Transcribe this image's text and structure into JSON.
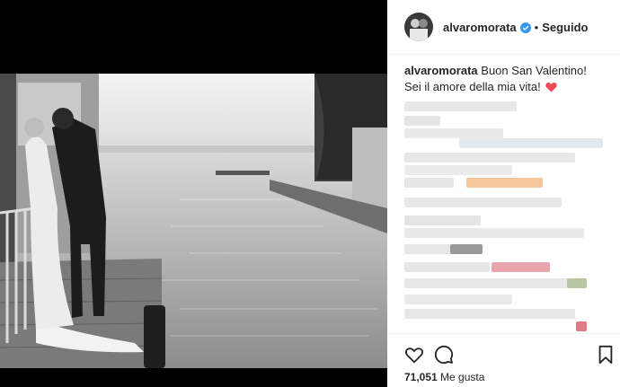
{
  "post": {
    "username": "alvaromorata",
    "follow_status": "Seguido",
    "separator": "•",
    "caption_text": "Buon San Valentino! Sei il amore della mia vita!",
    "likes_count": "71,051",
    "likes_label": "Me gusta"
  },
  "colors": {
    "text": "#262626",
    "verified": "#3897f0",
    "heart": "#ed4956",
    "blur": "#e6e6e6"
  },
  "icons": {
    "like": "heart-outline-icon",
    "comment": "speech-bubble-icon",
    "save": "bookmark-icon",
    "verified": "verified-badge-icon",
    "caption_emoji": "red-heart-emoji"
  }
}
